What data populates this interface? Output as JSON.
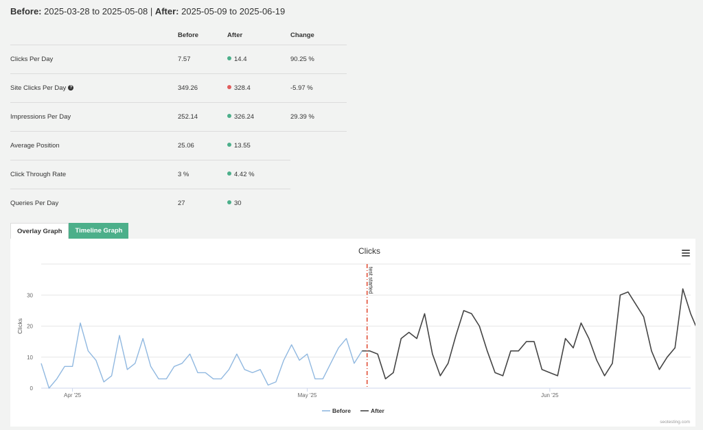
{
  "period": {
    "before_label": "Before:",
    "before_range": "2025-03-28 to 2025-05-08",
    "separator": "|",
    "after_label": "After:",
    "after_range": "2025-05-09 to 2025-06-19"
  },
  "table": {
    "headers": [
      "",
      "Before",
      "After",
      "Change"
    ],
    "rows": [
      {
        "metric": "Clicks Per Day",
        "before": "7.57",
        "after": "14.4",
        "status": "up",
        "change": "90.25 %"
      },
      {
        "metric": "Site Clicks Per Day",
        "help": "?",
        "before": "349.26",
        "after": "328.4",
        "status": "down",
        "change": "-5.97 %"
      },
      {
        "metric": "Impressions Per Day",
        "before": "252.14",
        "after": "326.24",
        "status": "up",
        "change": "29.39 %"
      },
      {
        "metric": "Average Position",
        "before": "25.06",
        "after": "13.55",
        "status": "up",
        "change": ""
      },
      {
        "metric": "Click Through Rate",
        "before": "3 %",
        "after": "4.42 %",
        "status": "up",
        "change": ""
      },
      {
        "metric": "Queries Per Day",
        "before": "27",
        "after": "30",
        "status": "up",
        "change": ""
      }
    ]
  },
  "tabs": [
    {
      "label": "Overlay Graph",
      "active": false
    },
    {
      "label": "Timeline Graph",
      "active": true
    }
  ],
  "colors": {
    "up": "#4caf8a",
    "down": "#e05c5c",
    "before_line": "#90b8e0",
    "after_line": "#444444",
    "marker": "#e0452b",
    "accent": "#4caf8a"
  },
  "chart_data": {
    "type": "line",
    "title": "Clicks",
    "ylabel": "Clicks",
    "xlabel": "",
    "ylim": [
      0,
      40
    ],
    "yticks": [
      0,
      10,
      20,
      30
    ],
    "xticks": [
      {
        "label": "Apr '25",
        "date": "2025-04-01"
      },
      {
        "label": "May '25",
        "date": "2025-05-01"
      },
      {
        "label": "Jun '25",
        "date": "2025-06-01"
      }
    ],
    "xrange": [
      "2025-03-28",
      "2025-06-19"
    ],
    "marker": {
      "date": "2025-05-09",
      "label": "test started"
    },
    "series": [
      {
        "name": "Before",
        "color": "#90b8e0",
        "start": "2025-03-28",
        "values": [
          8,
          0,
          3,
          7,
          7,
          21,
          12,
          9,
          2,
          4,
          17,
          6,
          8,
          16,
          7,
          3,
          3,
          7,
          8,
          11,
          5,
          5,
          3,
          3,
          6,
          11,
          6,
          5,
          6,
          1,
          2,
          9,
          14,
          9,
          11,
          3,
          3,
          8,
          13,
          16,
          8,
          12
        ]
      },
      {
        "name": "After",
        "color": "#444444",
        "start": "2025-05-09",
        "values": [
          12,
          11,
          3,
          5,
          16,
          18,
          16,
          24,
          11,
          4,
          8,
          17,
          25,
          24,
          20,
          12,
          5,
          4,
          12,
          12,
          15,
          15,
          6,
          5,
          4,
          16,
          13,
          21,
          16,
          9,
          4,
          8,
          30,
          31,
          27,
          23,
          12,
          6,
          10,
          13,
          32,
          24,
          18
        ]
      }
    ],
    "legend_position": "bottom-center",
    "grid": true
  },
  "watermark": "seotesting.com"
}
